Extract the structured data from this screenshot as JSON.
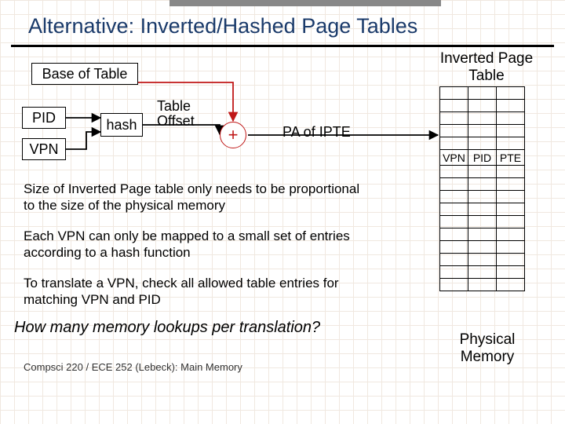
{
  "title": "Alternative: Inverted/Hashed Page Tables",
  "boxes": {
    "base": "Base of Table",
    "pid": "PID",
    "vpn": "VPN",
    "hash": "hash"
  },
  "labels": {
    "table_offset": "Table\nOffset",
    "plus": "+",
    "pa_of_ipte": "PA of IPTE",
    "ipt_title": "Inverted Page Table",
    "phys_mem": "Physical Memory"
  },
  "ipt_headers": [
    "VPN",
    "PID",
    "PTE"
  ],
  "paragraphs": [
    "Size of Inverted Page table only needs to be proportional to the size of the physical memory",
    "Each VPN can only be mapped to a small set of entries according to a hash function",
    "To translate a VPN, check all allowed table entries for matching VPN and PID"
  ],
  "question": "How many memory lookups per translation?",
  "footer": "Compsci 220 / ECE 252 (Lebeck): Main Memory"
}
